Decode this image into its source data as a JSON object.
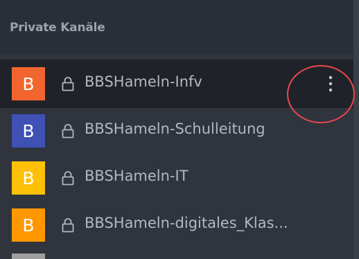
{
  "section": {
    "title": "Private Kanäle"
  },
  "channels": [
    {
      "initial": "B",
      "name": "BBSHameln-Infv",
      "avatar_color": "#f2652f",
      "active": true,
      "icon": "lock-icon"
    },
    {
      "initial": "B",
      "name": "BBSHameln-Schulleitung",
      "avatar_color": "#3f51b5",
      "active": false,
      "icon": "lock-icon"
    },
    {
      "initial": "B",
      "name": "BBSHameln-IT",
      "avatar_color": "#ffc107",
      "active": false,
      "icon": "lock-icon"
    },
    {
      "initial": "B",
      "name": "BBSHameln-digitales_Klas...",
      "avatar_color": "#ff9800",
      "active": false,
      "icon": "lock-icon"
    }
  ],
  "menu_icon": "kebab-menu-icon",
  "annotation_color": "#e8474f",
  "partial_avatar_color": "#9e9e9e"
}
